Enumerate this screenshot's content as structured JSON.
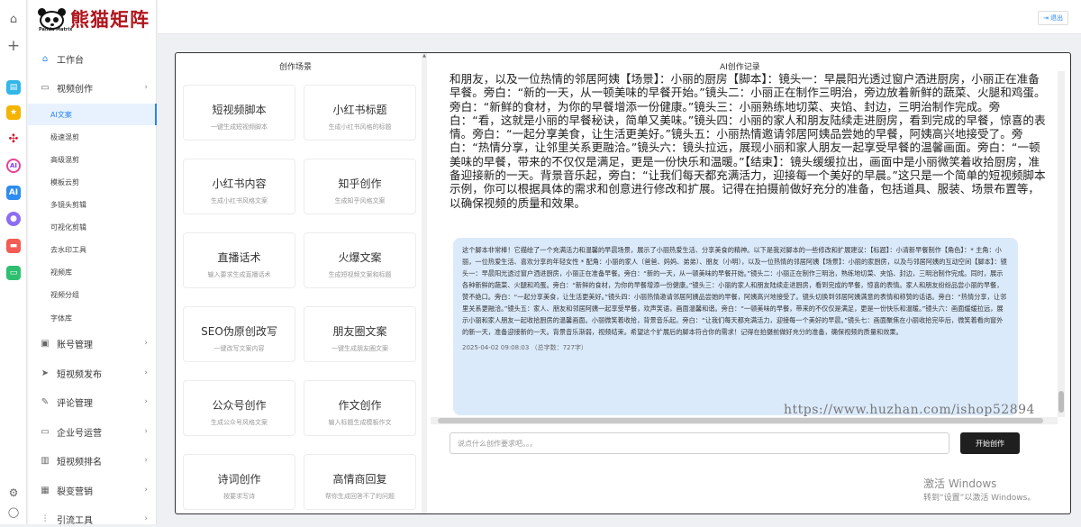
{
  "brand": {
    "name": "熊猫矩阵",
    "sub": "Panda Matrix"
  },
  "header": {
    "logout": "退出"
  },
  "nav": {
    "workbench": "工作台",
    "video_creation": "视频创作",
    "video_sub": [
      "AI文案",
      "极速混剪",
      "高级混剪",
      "模板云剪",
      "多镜头剪辑",
      "可视化剪辑",
      "去水印工具",
      "视频库",
      "视频分组",
      "字体库"
    ],
    "groups": [
      "账号管理",
      "短视频发布",
      "评论管理",
      "企业号运营",
      "短视频排名",
      "裂变营销",
      "引流工具"
    ]
  },
  "scenes": {
    "title": "创作场景",
    "cards": [
      {
        "title": "短视频脚本",
        "desc": "一键生成短视频脚本"
      },
      {
        "title": "小红书标题",
        "desc": "生成小红书风格的标题"
      },
      {
        "title": "小红书内容",
        "desc": "生成小红书风格文案"
      },
      {
        "title": "知乎创作",
        "desc": "生成知乎风格文案"
      },
      {
        "title": "直播话术",
        "desc": "输入要求生成直播话术"
      },
      {
        "title": "火爆文案",
        "desc": "生成短视频文案和标题"
      },
      {
        "title": "SEO伪原创改写",
        "desc": "一键改写文案内容"
      },
      {
        "title": "朋友圈文案",
        "desc": "一键生成朋友圈文案"
      },
      {
        "title": "公众号创作",
        "desc": "生成公众号风格文案"
      },
      {
        "title": "作文创作",
        "desc": "输入标题生成模板作文"
      },
      {
        "title": "诗词创作",
        "desc": "按要求写诗"
      },
      {
        "title": "高情商回复",
        "desc": "帮你生成回答不了的问题"
      }
    ]
  },
  "history": {
    "title": "AI创作记录",
    "reply_text": "和朋友，以及一位热情的邻居阿姨【场景】：小丽的厨房【脚本】：镜头一：早晨阳光透过窗户洒进厨房，小丽正在准备早餐。旁白：“新的一天，从一顿美味的早餐开始。”镜头二：小丽正在制作三明治，旁边放着新鲜的蔬菜、火腿和鸡蛋。旁白：“新鲜的食材，为你的早餐增添一份健康。”镜头三：小丽熟练地切菜、夹馅、封边，三明治制作完成。旁白：“看，这就是小丽的早餐秘诀，简单又美味。”镜头四：小丽的家人和朋友陆续走进厨房，看到完成的早餐，惊喜的表情。旁白：“一起分享美食，让生活更美好。”镜头五：小丽热情邀请邻居阿姨品尝她的早餐，阿姨高兴地接受了。旁白：“热情分享，让邻里关系更融洽。”镜头六：镜头拉远，展现小丽和家人朋友一起享受早餐的温馨画面。旁白：“一顿美味的早餐，带来的不仅仅是满足，更是一份快乐和温暖。”【结束】：镜头缓缓拉出，画面中是小丽微笑着收拾厨房，准备迎接新的一天。背景音乐起，旁白：“让我们每天都充满活力，迎接每一个美好的早晨。”这只是一个简单的短视频脚本示例，你可以根据具体的需求和创意进行修改和扩展。记得在拍摄前做好充分的准备，包括道具、服装、场景布置等，以确保视频的质量和效果。",
    "user_text": "这个脚本非常棒！它描绘了一个充满活力和温馨的早晨场景，展示了小丽热爱生活、分享美食的精神。以下是我对脚本的一些修改和扩展建议：【标题】：小清新早餐制作【角色】：* 主角：小丽，一位热爱生活、喜欢分享的年轻女性 * 配角：小丽的家人（爸爸、妈妈、弟弟）、朋友（小明），以及一位热情的邻居阿姨【场景】：小丽的家厨房，以及与邻居阿姨的互动空间【脚本】：镜头一：早晨阳光透过窗户洒进厨房，小丽正在准备早餐。旁白：“新的一天，从一顿美味的早餐开始。”镜头二：小丽正在制作三明治，熟练地切菜、夹馅、封边，三明治制作完成。同时，展示各种新鲜的蔬菜、火腿和鸡蛋。旁白：“新鲜的食材，为你的早餐增添一份健康。”镜头三：小丽的家人和朋友陆续走进厨房，看到完成的早餐，惊喜的表情。家人和朋友纷纷品尝小丽的早餐，赞不绝口。旁白：“一起分享美食，让生活更美好。”镜头四：小丽热情邀请邻居阿姨品尝她的早餐，阿姨高兴地接受了。镜头切换到邻居阿姨满意的表情和称赞的话语。旁白：“热情分享，让邻里关系更融洽。”镜头五：家人、朋友和邻居阿姨一起享受早餐，欢声笑语，画面温馨和谐。旁白：“一顿美味的早餐，带来的不仅仅是满足，更是一份快乐和温暖。”镜头六：画面缓缓拉远，展示小丽和家人朋友一起收拾厨房的温馨画面。小丽微笑着收拾，背景音乐起。旁白：“让我们每天都充满活力，迎接每一个美好的早晨。”镜头七：画面聚焦在小丽收拾完毕后，微笑着看向窗外的新一天，准备迎接新的一天。背景音乐渐弱，视频结束。希望这个扩展后的脚本符合你的需求！记得在拍摄前做好充分的准备，确保视频的质量和效果。",
    "meta": "2025-04-02 09:08:03 （总字数：727字）",
    "watermark": "https://www.huzhan.com/ishop52894"
  },
  "composer": {
    "placeholder": "说点什么创作要求吧。。。",
    "submit": "开始创作"
  },
  "windows": {
    "line1": "激活 Windows",
    "line2": "转到“设置”以激活 Windows。"
  },
  "colors": {
    "accent": "#2a84f5",
    "brand": "#b0151d",
    "bubble": "#dbeafb",
    "button": "#1f1f1f"
  }
}
